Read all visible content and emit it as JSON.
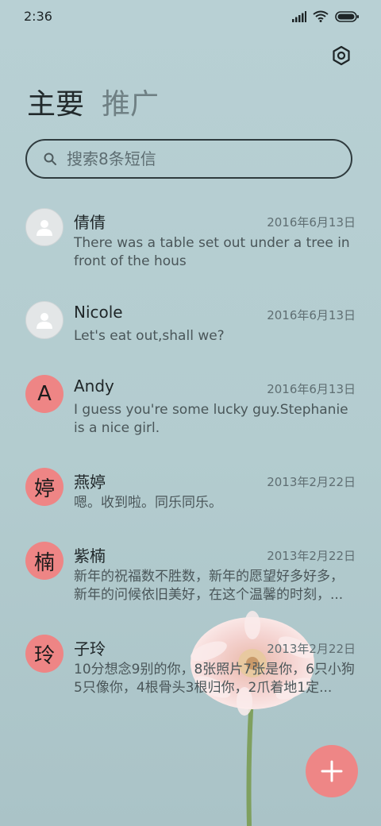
{
  "status_bar": {
    "time": "2:36"
  },
  "tabs": [
    {
      "label": "主要",
      "active": true
    },
    {
      "label": "推广",
      "active": false
    }
  ],
  "search": {
    "placeholder": "搜索8条短信"
  },
  "messages": [
    {
      "avatar": "person-icon",
      "name": "倩倩",
      "date": "2016年6月13日",
      "preview": "There was a table set out under a tree in front of the hous"
    },
    {
      "avatar": "person-icon",
      "name": "Nicole",
      "date": "2016年6月13日",
      "preview": "Let's eat out,shall we?"
    },
    {
      "avatar_text": "A",
      "name": "Andy",
      "date": "2016年6月13日",
      "preview": "I guess you're some lucky guy.Stephanie is a nice girl."
    },
    {
      "avatar_text": "婷",
      "name": "燕婷",
      "date": "2013年2月22日",
      "preview": "嗯。收到啦。同乐同乐。"
    },
    {
      "avatar_text": "楠",
      "name": "紫楠",
      "date": "2013年2月22日",
      "preview": "新年的祝福数不胜数，新年的愿望好多好多，新年的问候依旧美好，在这个温馨的时刻，..."
    },
    {
      "avatar_text": "玲",
      "name": "子玲",
      "date": "2013年2月22日",
      "preview": "10分想念9别的你，8张照片7张是你，6只小狗5只像你，4根骨头3根归你，2爪着地1定..."
    }
  ],
  "colors": {
    "accent": "#ee8686",
    "background": "#b8d0d4"
  },
  "icons": [
    "signal-icon",
    "wifi-icon",
    "battery-icon",
    "settings-icon",
    "search-icon",
    "person-icon",
    "plus-icon"
  ]
}
